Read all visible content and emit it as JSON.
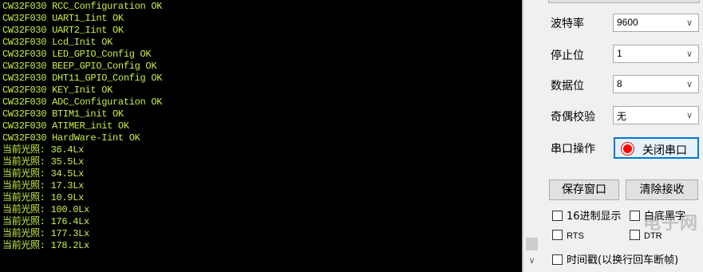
{
  "terminal": {
    "lines": [
      "CW32F030 RCC_Configuration OK",
      "CW32F030 UART1_Iint OK",
      "CW32F030 UART2_Iint OK",
      "CW32F030 Lcd_Init OK",
      "CW32F030 LED_GPIO_Config OK",
      "CW32F030 BEEP_GPIO_Config OK",
      "CW32F030 DHT11_GPIO_Config OK",
      "CW32F030 KEY_Init OK",
      "CW32F030 ADC_Configuration OK",
      "CW32F030 BTIM1_init OK",
      "CW32F030 ATIMER_init OK",
      "CW32F030 HardWare-Iint OK",
      "当前光照: 36.4Lx",
      "当前光照: 35.5Lx",
      "当前光照: 34.5Lx",
      "当前光照: 17.3Lx",
      "当前光照: 10.9Lx",
      "当前光照: 100.0Lx",
      "当前光照: 176.4Lx",
      "当前光照: 177.3Lx",
      "当前光照: 178.2Lx"
    ]
  },
  "settings": {
    "baud_label": "波特率",
    "baud_value": "9600",
    "stop_label": "停止位",
    "stop_value": "1",
    "data_label": "数据位",
    "data_value": "8",
    "parity_label": "奇偶校验",
    "parity_value": "无",
    "port_op_label": "串口操作",
    "port_button": "关闭串口"
  },
  "buttons": {
    "save_window": "保存窗口",
    "clear_receive": "清除接收"
  },
  "options": {
    "hex_display": "16进制显示",
    "white_bg": "白底黑字",
    "rts": "RTS",
    "dtr": "DTR",
    "timestamp": "时间戳(以换行回车断帧)"
  },
  "watermark": "电子网",
  "colors": {
    "terminal_bg": "#000000",
    "terminal_text": "#c8f046",
    "port_button_border": "#0078d7",
    "record_icon": "#ff0000"
  }
}
